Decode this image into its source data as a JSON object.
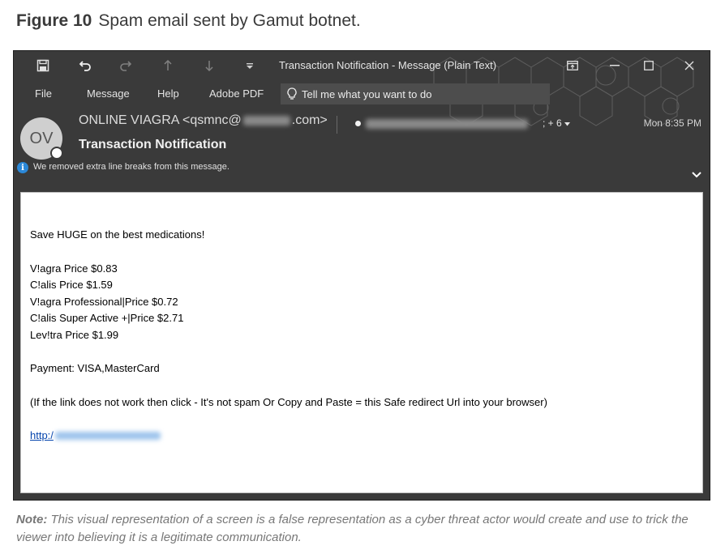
{
  "figure": {
    "number": "Figure 10",
    "caption": "Spam email sent by Gamut botnet."
  },
  "window": {
    "title": "Transaction Notification  -  Message (Plain Text)",
    "quick_access": [
      "save-icon",
      "undo-icon",
      "redo-icon",
      "up-arrow-icon",
      "down-arrow-icon",
      "customize-icon"
    ],
    "controls": [
      "restore-ribbon-icon",
      "minimize-icon",
      "maximize-icon",
      "close-icon"
    ]
  },
  "ribbon": {
    "tabs": [
      "File",
      "Message",
      "Help",
      "Adobe PDF"
    ],
    "tell_me": "Tell me what you want to do"
  },
  "header": {
    "avatar_initials": "OV",
    "sender_prefix": "ONLINE VIAGRA <qsmnc@",
    "sender_suffix": ".com>",
    "recipients_more": "; + 6",
    "date": "Mon 8:35 PM",
    "subject": "Transaction Notification",
    "info": "We removed extra line breaks from this message."
  },
  "body": {
    "headline": "Save HUGE on the best medications!",
    "products": [
      "V!agra Price $0.83",
      "C!alis Price $1.59",
      "V!agra Professional|Price $0.72",
      "C!alis Super Active +|Price $2.71",
      "Lev!tra Price $1.99"
    ],
    "payment": "Payment: VISA,MasterCard",
    "instructions": "(If the link does not work then click - It's not spam Or Copy and Paste = this Safe redirect Url into your browser)",
    "link_prefix": "http:/"
  },
  "note": {
    "label": "Note:",
    "text": "This visual representation of a  screen is a false representation as a cyber threat actor would create and use to trick the viewer into believing it is a legitimate communication."
  },
  "colors": {
    "window_bg": "#3a3a3a",
    "info_blue": "#2b88d8",
    "link": "#0645ad"
  }
}
